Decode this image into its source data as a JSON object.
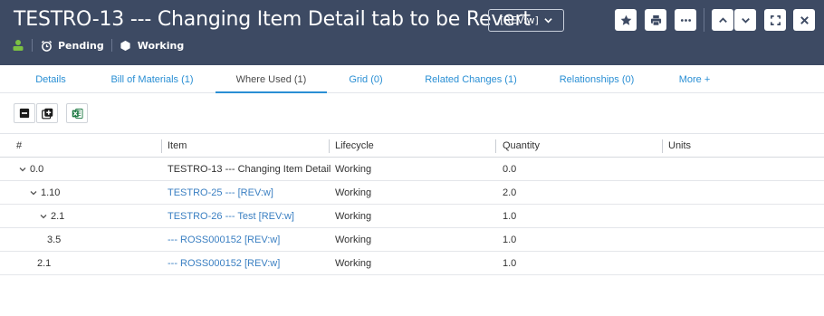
{
  "header": {
    "title": "TESTRO-13 --- Changing Item Detail tab to be Revert",
    "revision_label": "[REV:w]",
    "status": "Pending",
    "lifecycle": "Working"
  },
  "header_buttons": [
    "star-icon",
    "print-icon",
    "more-icon",
    "chevron-up-icon",
    "chevron-down-icon",
    "expand-icon",
    "close-icon"
  ],
  "tabs": [
    {
      "label": "Details",
      "active": false
    },
    {
      "label": "Bill of Materials (1)",
      "active": false
    },
    {
      "label": "Where Used (1)",
      "active": true
    },
    {
      "label": "Grid (0)",
      "active": false
    },
    {
      "label": "Related Changes (1)",
      "active": false
    },
    {
      "label": "Relationships (0)",
      "active": false
    },
    {
      "label": "More +",
      "active": false
    }
  ],
  "toolbar": [
    "collapse-all-icon",
    "expand-all-icon",
    "excel-export-icon"
  ],
  "table": {
    "columns": [
      "#",
      "Item",
      "Lifecycle",
      "Quantity",
      "Units"
    ],
    "rows": [
      {
        "num": "0.0",
        "item": "TESTRO-13 --- Changing Item Detail",
        "lifecycle": "Working",
        "quantity": "0.0",
        "units": "",
        "link": false
      },
      {
        "num": "1.10",
        "item": "TESTRO-25 --- [REV:w]",
        "lifecycle": "Working",
        "quantity": "2.0",
        "units": "",
        "link": true
      },
      {
        "num": "2.1",
        "item": "TESTRO-26 --- Test [REV:w]",
        "lifecycle": "Working",
        "quantity": "1.0",
        "units": "",
        "link": true
      },
      {
        "num": "3.5",
        "item": "--- ROSS000152 [REV:w]",
        "lifecycle": "Working",
        "quantity": "1.0",
        "units": "",
        "link": true
      },
      {
        "num": "2.1",
        "item": "--- ROSS000152 [REV:w]",
        "lifecycle": "Working",
        "quantity": "1.0",
        "units": "",
        "link": true
      }
    ]
  },
  "colors": {
    "header_bg": "#3d4a63",
    "link": "#3a7fc2",
    "tab_accent": "#2a8fd4",
    "excel_green": "#1f7a44"
  }
}
